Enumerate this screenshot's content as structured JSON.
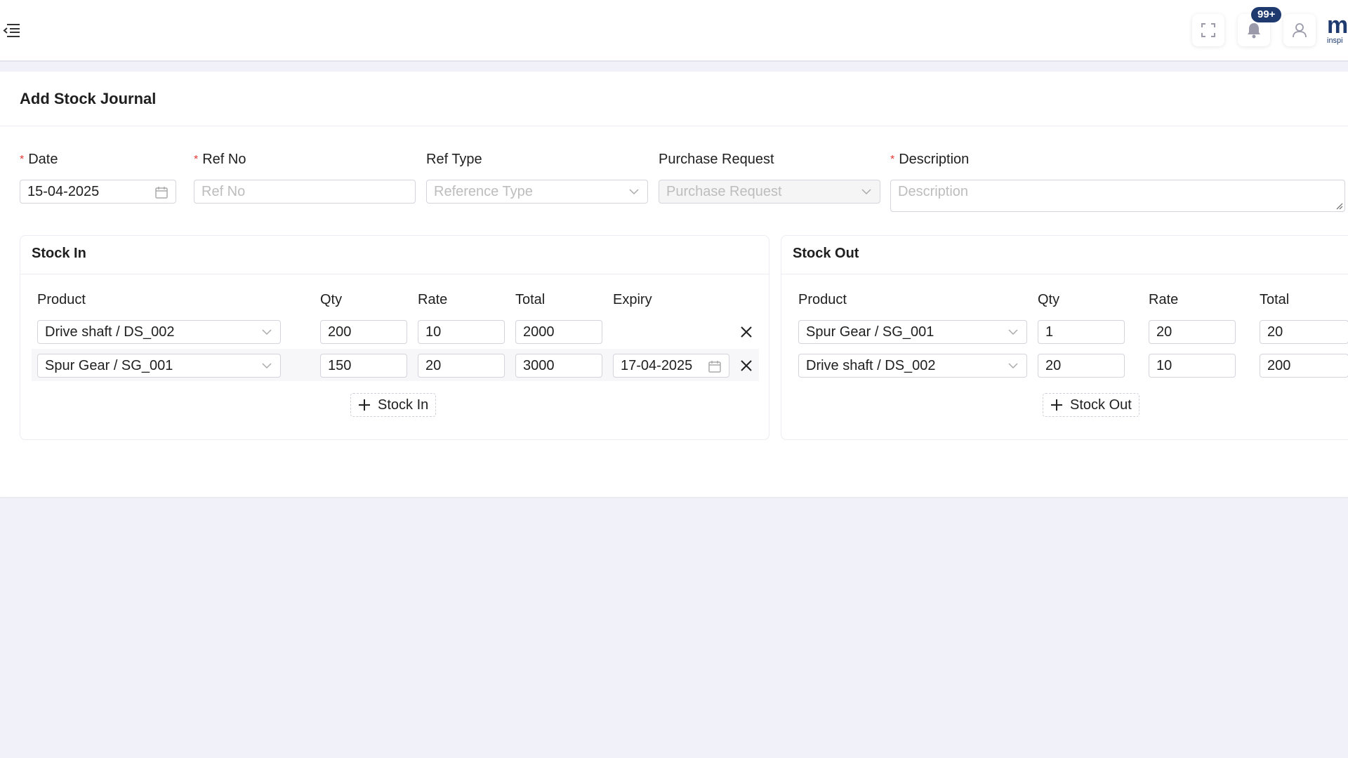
{
  "header": {
    "notification_count": "99+",
    "logo_mark": "m",
    "logo_sub": "inspi",
    "icons": [
      "menu-fold-icon",
      "fullscreen-icon",
      "bell-icon",
      "user-icon"
    ]
  },
  "page": {
    "title": "Add Stock Journal"
  },
  "form": {
    "date": {
      "label": "Date",
      "required": true,
      "value": "15-04-2025"
    },
    "ref_no": {
      "label": "Ref No",
      "required": true,
      "placeholder": "Ref No"
    },
    "ref_type": {
      "label": "Ref Type",
      "required": false,
      "placeholder": "Reference Type"
    },
    "purchase_request": {
      "label": "Purchase Request",
      "required": false,
      "placeholder": "Purchase Request",
      "disabled": true
    },
    "description": {
      "label": "Description",
      "required": true,
      "placeholder": "Description"
    }
  },
  "stock_in": {
    "title": "Stock In",
    "columns": [
      "Product",
      "Qty",
      "Rate",
      "Total",
      "Expiry"
    ],
    "rows": [
      {
        "product": "Drive shaft / DS_002",
        "qty": "200",
        "rate": "10",
        "total": "2000",
        "expiry": ""
      },
      {
        "product": "Spur Gear / SG_001",
        "qty": "150",
        "rate": "20",
        "total": "3000",
        "expiry": "17-04-2025"
      }
    ],
    "add_label": "Stock In"
  },
  "stock_out": {
    "title": "Stock Out",
    "columns": [
      "Product",
      "Qty",
      "Rate",
      "Total"
    ],
    "rows": [
      {
        "product": "Spur Gear / SG_001",
        "qty": "1",
        "rate": "20",
        "total": "20"
      },
      {
        "product": "Drive shaft / DS_002",
        "qty": "20",
        "rate": "10",
        "total": "200"
      }
    ],
    "add_label": "Stock Out"
  },
  "colors": {
    "background": "#f1f1fa",
    "required": "#e53935",
    "brand": "#1e3a6e",
    "border": "#d4d4dc",
    "placeholder": "#bdbdbd"
  }
}
